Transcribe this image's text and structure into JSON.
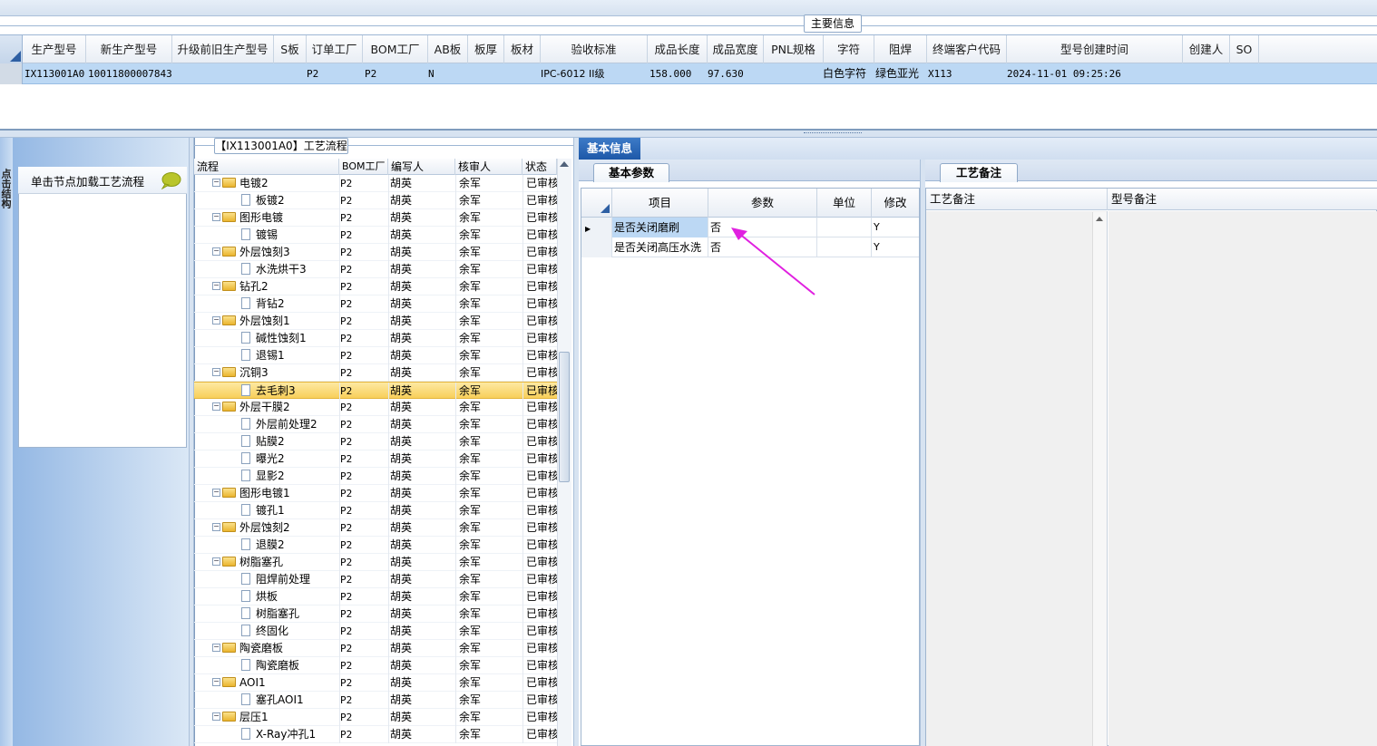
{
  "top": {
    "main_info_tab": "主要信息",
    "columns": [
      "生产型号",
      "新生产型号",
      "升级前旧生产型号",
      "S板",
      "订单工厂",
      "BOM工厂",
      "AB板",
      "板厚",
      "板材",
      "验收标准",
      "成品长度",
      "成品宽度",
      "PNL规格",
      "字符",
      "阻焊",
      "终端客户代码",
      "型号创建时间",
      "创建人",
      "SO"
    ],
    "row": {
      "prod_model": "IX113001A0",
      "new_prod_model": "10011800007843",
      "order_factory": "P2",
      "bom_factory": "P2",
      "ab_board": "N",
      "standard": "IPC-6012 II级",
      "length": "158.000",
      "width": "97.630",
      "char": "白色字符",
      "mask": "绿色亚光",
      "customer_code": "X113",
      "create_time": "2024-11-01 09:25:26"
    }
  },
  "left": {
    "strip_text": "点击结构",
    "node_label": "单击节点加载工艺流程"
  },
  "tree": {
    "title": "【IX113001A0】工艺流程",
    "headers": [
      "流程",
      "BOM工厂",
      "编写人",
      "核审人",
      "状态"
    ],
    "rows": [
      {
        "level": 0,
        "name": "电镀2",
        "bom": "P2",
        "writer": "胡英",
        "reviewer": "余军",
        "status": "已审核"
      },
      {
        "level": 1,
        "name": "板镀2",
        "bom": "P2",
        "writer": "胡英",
        "reviewer": "余军",
        "status": "已审核"
      },
      {
        "level": 0,
        "name": "图形电镀",
        "bom": "P2",
        "writer": "胡英",
        "reviewer": "余军",
        "status": "已审核"
      },
      {
        "level": 1,
        "name": "镀锡",
        "bom": "P2",
        "writer": "胡英",
        "reviewer": "余军",
        "status": "已审核"
      },
      {
        "level": 0,
        "name": "外层蚀刻3",
        "bom": "P2",
        "writer": "胡英",
        "reviewer": "余军",
        "status": "已审核"
      },
      {
        "level": 1,
        "name": "水洗烘干3",
        "bom": "P2",
        "writer": "胡英",
        "reviewer": "余军",
        "status": "已审核"
      },
      {
        "level": 0,
        "name": "钻孔2",
        "bom": "P2",
        "writer": "胡英",
        "reviewer": "余军",
        "status": "已审核"
      },
      {
        "level": 1,
        "name": "背钻2",
        "bom": "P2",
        "writer": "胡英",
        "reviewer": "余军",
        "status": "已审核"
      },
      {
        "level": 0,
        "name": "外层蚀刻1",
        "bom": "P2",
        "writer": "胡英",
        "reviewer": "余军",
        "status": "已审核"
      },
      {
        "level": 1,
        "name": "碱性蚀刻1",
        "bom": "P2",
        "writer": "胡英",
        "reviewer": "余军",
        "status": "已审核"
      },
      {
        "level": 1,
        "name": "退锡1",
        "bom": "P2",
        "writer": "胡英",
        "reviewer": "余军",
        "status": "已审核"
      },
      {
        "level": 0,
        "name": "沉铜3",
        "bom": "P2",
        "writer": "胡英",
        "reviewer": "余军",
        "status": "已审核"
      },
      {
        "level": 1,
        "name": "去毛刺3",
        "bom": "P2",
        "writer": "胡英",
        "reviewer": "余军",
        "status": "已审核",
        "selected": true
      },
      {
        "level": 0,
        "name": "外层干膜2",
        "bom": "P2",
        "writer": "胡英",
        "reviewer": "余军",
        "status": "已审核"
      },
      {
        "level": 1,
        "name": "外层前处理2",
        "bom": "P2",
        "writer": "胡英",
        "reviewer": "余军",
        "status": "已审核"
      },
      {
        "level": 1,
        "name": "贴膜2",
        "bom": "P2",
        "writer": "胡英",
        "reviewer": "余军",
        "status": "已审核"
      },
      {
        "level": 1,
        "name": "曝光2",
        "bom": "P2",
        "writer": "胡英",
        "reviewer": "余军",
        "status": "已审核"
      },
      {
        "level": 1,
        "name": "显影2",
        "bom": "P2",
        "writer": "胡英",
        "reviewer": "余军",
        "status": "已审核"
      },
      {
        "level": 0,
        "name": "图形电镀1",
        "bom": "P2",
        "writer": "胡英",
        "reviewer": "余军",
        "status": "已审核"
      },
      {
        "level": 1,
        "name": "镀孔1",
        "bom": "P2",
        "writer": "胡英",
        "reviewer": "余军",
        "status": "已审核"
      },
      {
        "level": 0,
        "name": "外层蚀刻2",
        "bom": "P2",
        "writer": "胡英",
        "reviewer": "余军",
        "status": "已审核"
      },
      {
        "level": 1,
        "name": "退膜2",
        "bom": "P2",
        "writer": "胡英",
        "reviewer": "余军",
        "status": "已审核"
      },
      {
        "level": 0,
        "name": "树脂塞孔",
        "bom": "P2",
        "writer": "胡英",
        "reviewer": "余军",
        "status": "已审核"
      },
      {
        "level": 1,
        "name": "阻焊前处理",
        "bom": "P2",
        "writer": "胡英",
        "reviewer": "余军",
        "status": "已审核"
      },
      {
        "level": 1,
        "name": "烘板",
        "bom": "P2",
        "writer": "胡英",
        "reviewer": "余军",
        "status": "已审核"
      },
      {
        "level": 1,
        "name": "树脂塞孔",
        "bom": "P2",
        "writer": "胡英",
        "reviewer": "余军",
        "status": "已审核"
      },
      {
        "level": 1,
        "name": "终固化",
        "bom": "P2",
        "writer": "胡英",
        "reviewer": "余军",
        "status": "已审核"
      },
      {
        "level": 0,
        "name": "陶瓷磨板",
        "bom": "P2",
        "writer": "胡英",
        "reviewer": "余军",
        "status": "已审核"
      },
      {
        "level": 1,
        "name": "陶瓷磨板",
        "bom": "P2",
        "writer": "胡英",
        "reviewer": "余军",
        "status": "已审核"
      },
      {
        "level": 0,
        "name": "AOI1",
        "bom": "P2",
        "writer": "胡英",
        "reviewer": "余军",
        "status": "已审核"
      },
      {
        "level": 1,
        "name": "塞孔AOI1",
        "bom": "P2",
        "writer": "胡英",
        "reviewer": "余军",
        "status": "已审核"
      },
      {
        "level": 0,
        "name": "层压1",
        "bom": "P2",
        "writer": "胡英",
        "reviewer": "余军",
        "status": "已审核"
      },
      {
        "level": 1,
        "name": "X-Ray冲孔1",
        "bom": "P2",
        "writer": "胡英",
        "reviewer": "余军",
        "status": "已审核"
      }
    ]
  },
  "right": {
    "basic_info_tab": "基本信息",
    "basic_param_tab": "基本参数",
    "proc_note_tab": "工艺备注",
    "param_headers": [
      "项目",
      "参数",
      "单位",
      "修改"
    ],
    "params": [
      {
        "item": "是否关闭磨刷",
        "value": "否",
        "unit": "",
        "modify": "Y"
      },
      {
        "item": "是否关闭高压水洗",
        "value": "否",
        "unit": "",
        "modify": "Y"
      }
    ],
    "note_headers": [
      "工艺备注",
      "型号备注"
    ]
  },
  "colors": {
    "selection": "#bcd8f4",
    "tree_selection": "#f8cf5a",
    "tab_active": "#1d58a8",
    "arrow": "#e020e0"
  }
}
